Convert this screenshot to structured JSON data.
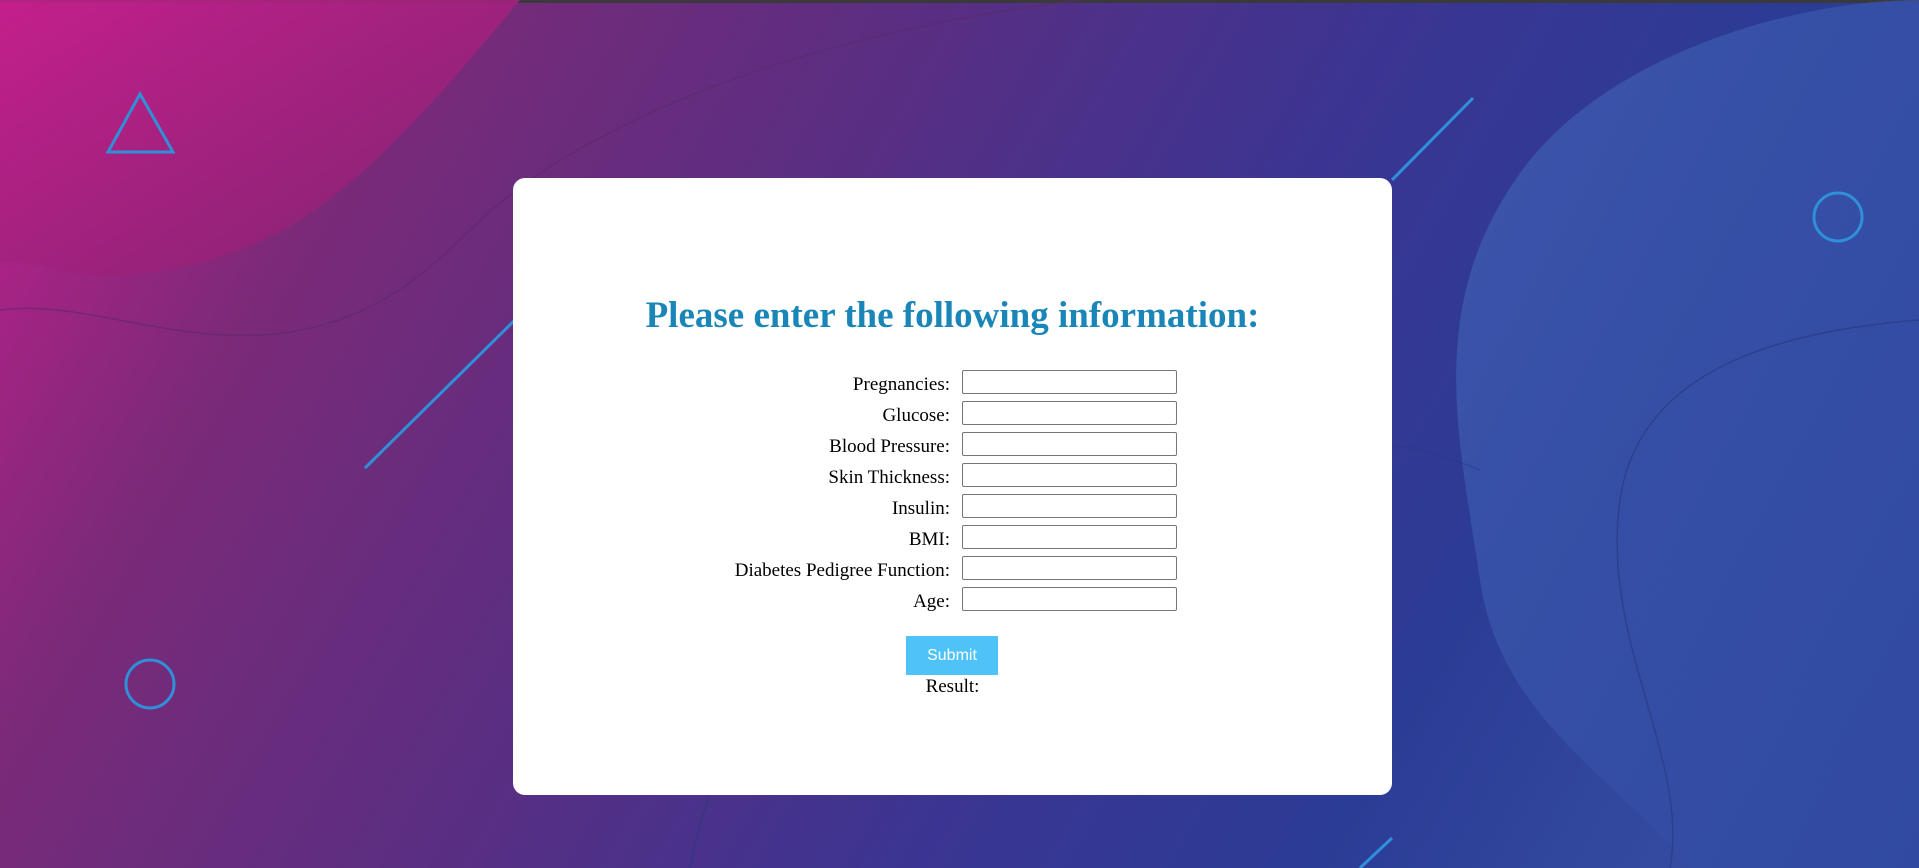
{
  "page": {
    "heading": "Please enter the following information:",
    "colors": {
      "heading": "#1a86b8",
      "submit_bg": "#4fc3f7",
      "card_bg": "#ffffff"
    }
  },
  "form": {
    "fields": [
      {
        "label": "Pregnancies:",
        "value": ""
      },
      {
        "label": "Glucose:",
        "value": ""
      },
      {
        "label": "Blood Pressure:",
        "value": ""
      },
      {
        "label": "Skin Thickness:",
        "value": ""
      },
      {
        "label": "Insulin:",
        "value": ""
      },
      {
        "label": "BMI:",
        "value": ""
      },
      {
        "label": "Diabetes Pedigree Function:",
        "value": ""
      },
      {
        "label": "Age:",
        "value": ""
      }
    ],
    "submit_label": "Submit",
    "result_label": "Result:"
  },
  "decorations": {
    "icons": [
      "triangle-icon",
      "circle-icon",
      "circle-icon"
    ]
  }
}
